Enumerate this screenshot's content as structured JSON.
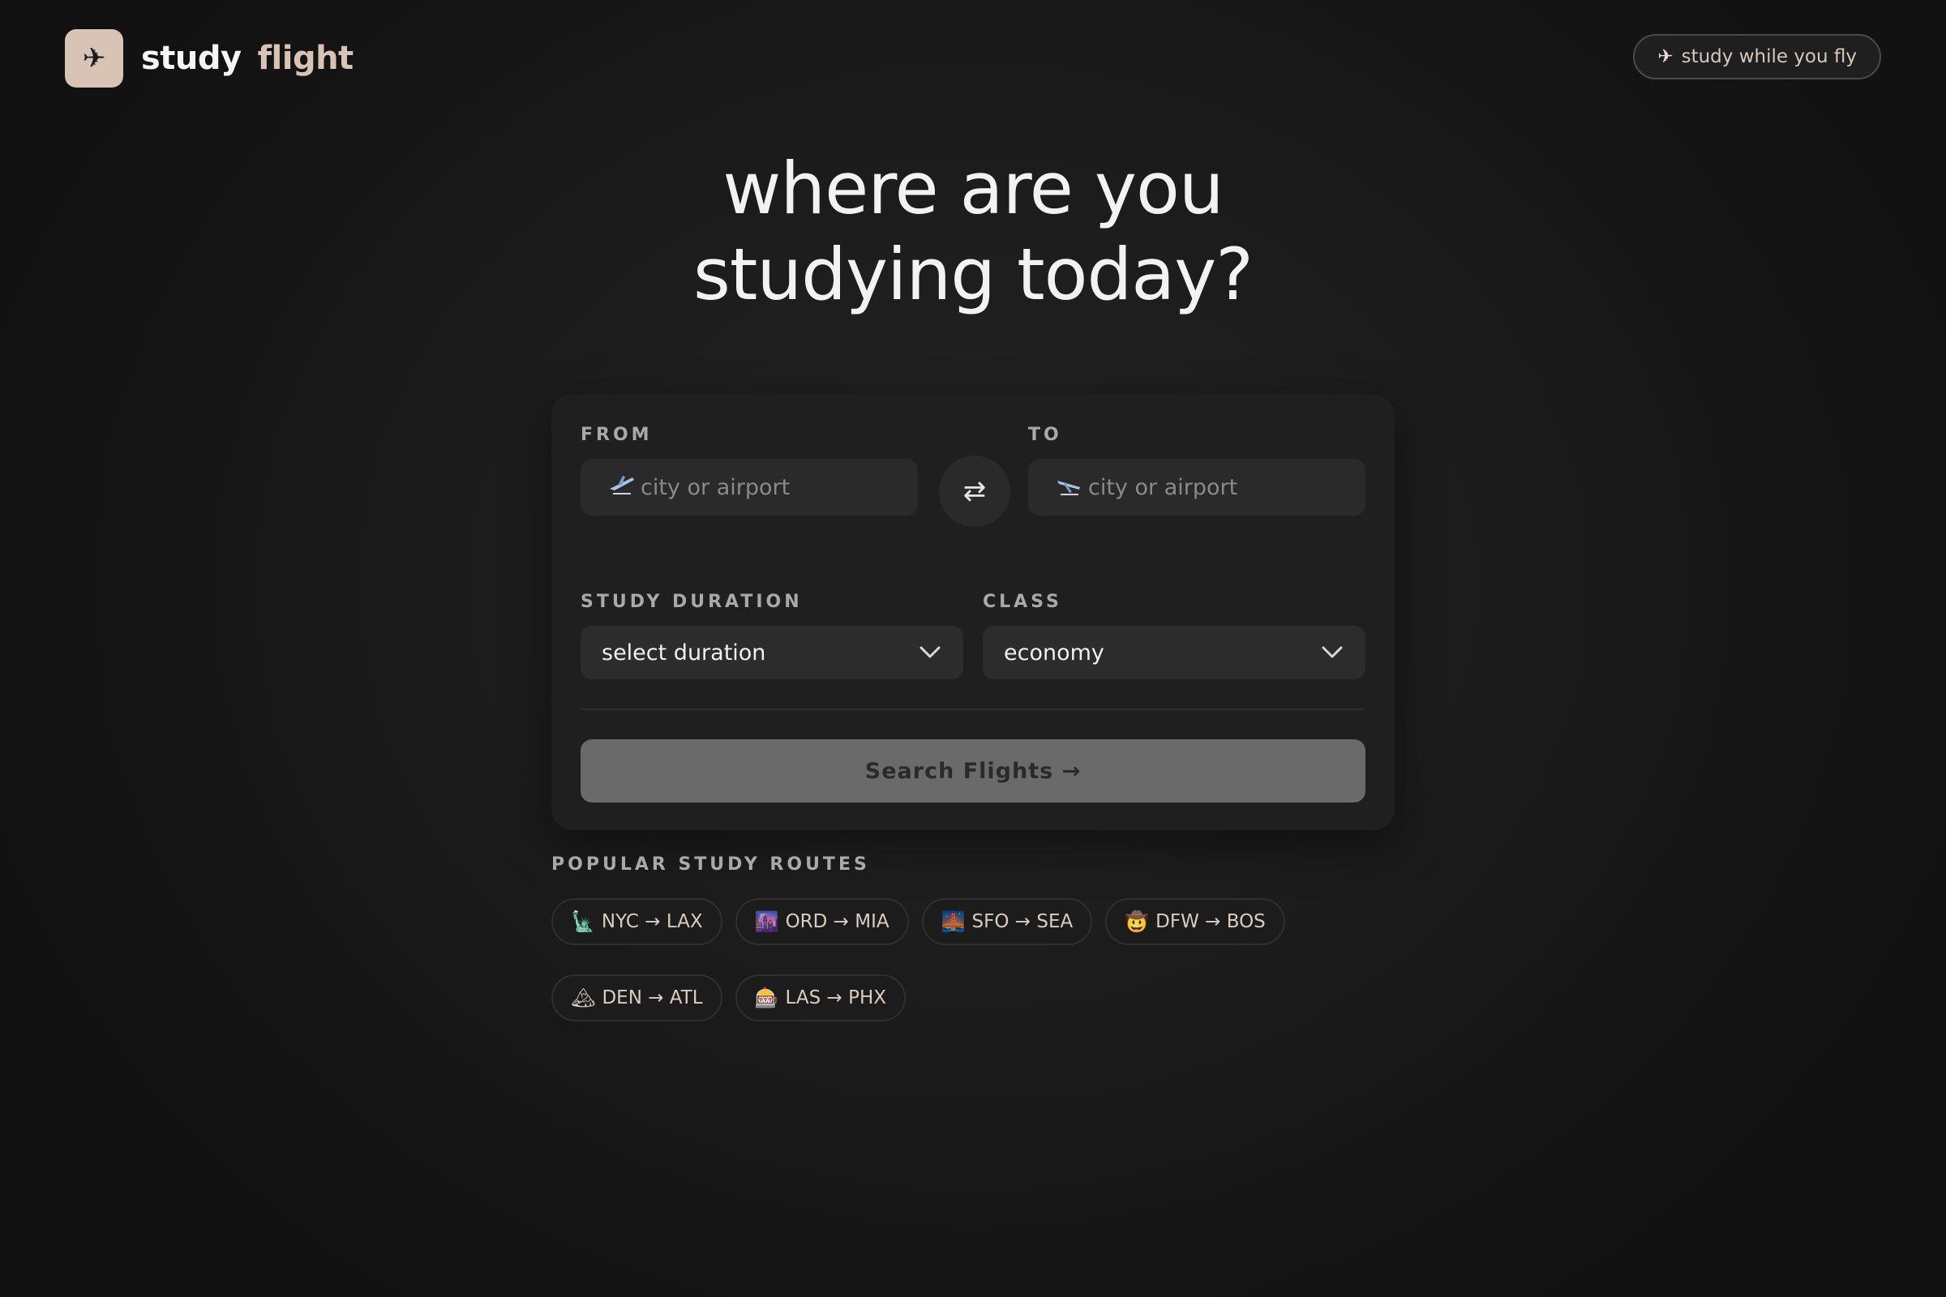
{
  "brand": {
    "icon": "airplane-icon",
    "icon_glyph": "✈",
    "word1": "study",
    "word2": "flight",
    "badge_color": "#d9c3b4"
  },
  "header": {
    "tagline_glyph": "✈",
    "tagline": "study while you fly"
  },
  "hero": {
    "line1": "where are you",
    "line2": "studying today?"
  },
  "form": {
    "from_label": "FROM",
    "to_label": "TO",
    "from_placeholder": "city or airport",
    "to_placeholder": "city or airport",
    "from_icon": "departure-icon",
    "to_icon": "arrival-icon",
    "swap_glyph": "⇄",
    "duration_label": "STUDY DURATION",
    "duration_value": "select duration",
    "class_label": "CLASS",
    "class_value": "economy",
    "search_label": "Search Flights →"
  },
  "popular": {
    "label": "POPULAR STUDY ROUTES",
    "routes": [
      {
        "emoji": "🗽",
        "label": "NYC → LAX"
      },
      {
        "emoji": "🌆",
        "label": "ORD → MIA"
      },
      {
        "emoji": "🌉",
        "label": "SFO → SEA"
      },
      {
        "emoji": "🤠",
        "label": "DFW → BOS"
      },
      {
        "emoji": "🏔",
        "label": "DEN → ATL"
      },
      {
        "emoji": "🎰",
        "label": "LAS → PHX"
      }
    ]
  },
  "colors": {
    "background": "#151515",
    "card": "#1f1f1f",
    "accent": "#d9c3b4",
    "button_disabled": "#6a6a6a"
  }
}
